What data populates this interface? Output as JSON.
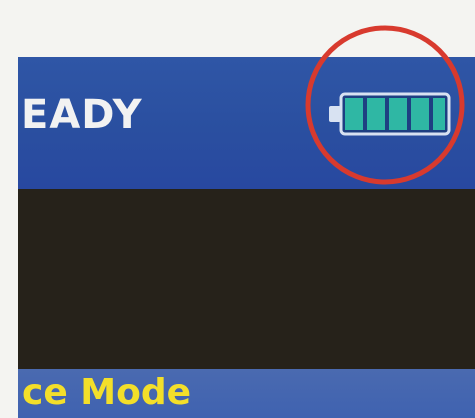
{
  "status": {
    "text": "EADY",
    "battery_icon": "battery-full-icon",
    "battery_level": 1.0,
    "battery_segments": 4
  },
  "mode": {
    "text": "ce Mode"
  },
  "colors": {
    "status_bar": "#2f56a6",
    "content_bg": "#26221a",
    "mode_bar": "#4a6ab0",
    "mode_text": "#f3df2a",
    "battery_fill": "#2fb7a4",
    "highlight_ring": "#d83a2e"
  }
}
